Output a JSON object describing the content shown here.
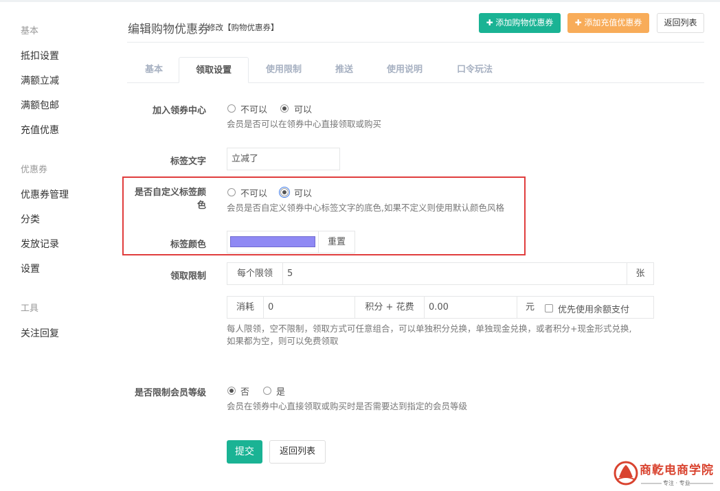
{
  "sidebar": {
    "group_basic": "基本",
    "items_basic": [
      "抵扣设置",
      "满额立减",
      "满额包邮",
      "充值优惠"
    ],
    "group_coupon": "优惠券",
    "items_coupon": [
      "优惠券管理",
      "分类",
      "发放记录",
      "设置"
    ],
    "group_tools": "工具",
    "items_tools": [
      "关注回复"
    ]
  },
  "header": {
    "title": "编辑购物优惠券",
    "subtitle": "修改【购物优惠券】",
    "btn_add_shop": "✚ 添加购物优惠券",
    "btn_add_recharge": "✚ 添加充值优惠券",
    "btn_back": "返回列表"
  },
  "tabs": [
    "基本",
    "领取设置",
    "使用限制",
    "推送",
    "使用说明",
    "口令玩法"
  ],
  "form": {
    "join_center": {
      "label": "加入领券中心",
      "opt_no": "不可以",
      "opt_yes": "可以",
      "selected": "可以",
      "help": "会员是否可以在领券中心直接领取或购买"
    },
    "tag_text": {
      "label": "标签文字",
      "value": "立减了"
    },
    "custom_color": {
      "label_line1": "是否自定义标签颜",
      "label_line2": "色",
      "opt_no": "不可以",
      "opt_yes": "可以",
      "selected": "可以",
      "help": "会员是否自定义领券中心标签文字的底色,如果不定义则使用默认颜色风格"
    },
    "tag_color": {
      "label": "标签颜色",
      "color": "#8f89f4",
      "reset": "重置"
    },
    "claim_limit": {
      "label": "领取限制",
      "per_person": "每个限领",
      "value": "5",
      "unit": "张",
      "consume": "消耗",
      "consume_value": "0",
      "points_plus": "积分 + 花费",
      "money_value": "0.00",
      "yuan": "元",
      "balance_pay": "优先使用余额支付",
      "help_line1": "每人限领，空不限制，领取方式可任意组合，可以单独积分兑换，单独现金兑换，或者积分+现金形式兑换,",
      "help_line2": "如果都为空，则可以免费领取"
    },
    "level_limit": {
      "label": "是否限制会员等级",
      "opt_no": "否",
      "opt_yes": "是",
      "selected": "否",
      "help": "会员在领券中心直接领取或购买时是否需要达到指定的会员等级"
    },
    "submit": "提交",
    "back": "返回列表"
  },
  "watermark": {
    "brand": "商亁电商学院",
    "slogan": "专注 · 专业"
  },
  "colors": {
    "primary": "#1ab394",
    "warning": "#f8ac59",
    "highlight_border": "#e03c3c"
  }
}
